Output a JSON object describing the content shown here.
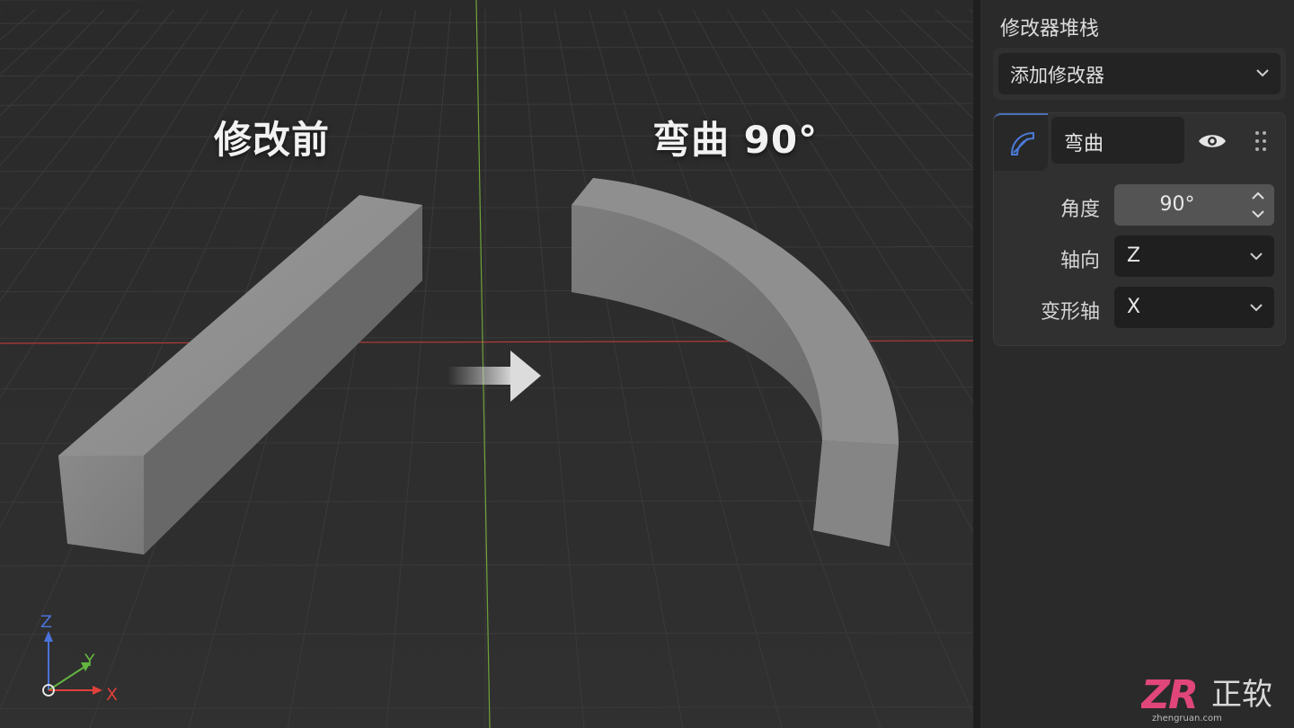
{
  "viewport": {
    "before_label": "修改前",
    "after_label": "弯曲 90°",
    "axes": {
      "z": "Z",
      "y": "Y",
      "x": "X"
    }
  },
  "panel": {
    "title": "修改器堆栈",
    "add_modifier": "添加修改器",
    "modifier": {
      "name": "弯曲",
      "properties": [
        {
          "label": "角度",
          "value": "90°",
          "control": "number-stepper"
        },
        {
          "label": "轴向",
          "value": "Z",
          "control": "dropdown"
        },
        {
          "label": "变形轴",
          "value": "X",
          "control": "dropdown"
        }
      ]
    }
  },
  "watermark": {
    "brand": "正软",
    "url": "zhengruan.com"
  },
  "colors": {
    "accent": "#4a6fb5",
    "x_axis": "#e0403a",
    "y_axis": "#63b53f",
    "z_axis": "#4a72d9"
  }
}
